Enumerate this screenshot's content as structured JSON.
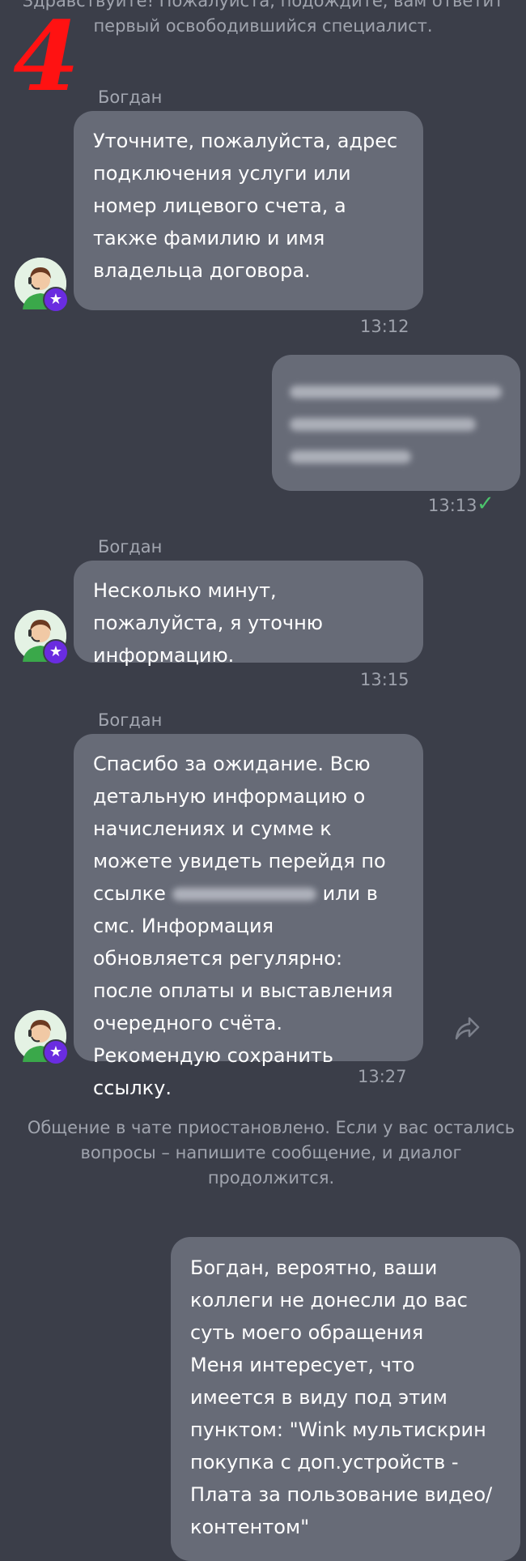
{
  "step_number": "4",
  "system_top": "Здравствуйте! Пожалуйста, подождите, вам ответит первый освободившийся специалист.",
  "messages": [
    {
      "sender": "Богдан",
      "text": "Уточните, пожалуйста, адрес подключения услуги или номер лицевого счета, а также фамилию и имя владельца договора.",
      "time": "13:12"
    },
    {
      "time": "13:13",
      "status_icon": "checkmark-icon"
    },
    {
      "sender": "Богдан",
      "text": "Несколько минут, пожалуйста, я уточню информацию.",
      "time": "13:15"
    },
    {
      "sender": "Богдан",
      "text_before": "Спасибо за ожидание. Всю детальную информацию о начислениях и сумме к можете увидеть перейдя по ссылке",
      "text_after": "или в смс. Информация обновляется регулярно: после оплаты и выставления очередного счёта. Рекомендую сохранить ссылку.",
      "time": "13:27"
    },
    {
      "text": "Богдан, вероятно, ваши коллеги не донесли до вас суть моего обращения\nМеня интересует, что имеется в виду под этим пунктом: \"Wink мультискрин покупка с доп.устройств - Плата за пользование видео/контентом\""
    }
  ],
  "system_pause": "Общение в чате приостановлено. Если у вас остались вопросы – напишите сообщение, и диалог продолжится.",
  "icons": {
    "avatar": "agent-avatar",
    "badge": "star-icon",
    "share": "share-icon"
  },
  "colors": {
    "background": "#3b3e49",
    "bubble": "#676b77",
    "badge": "#6a2ce0",
    "check": "#4cc46c",
    "step_number": "#ff1212"
  }
}
